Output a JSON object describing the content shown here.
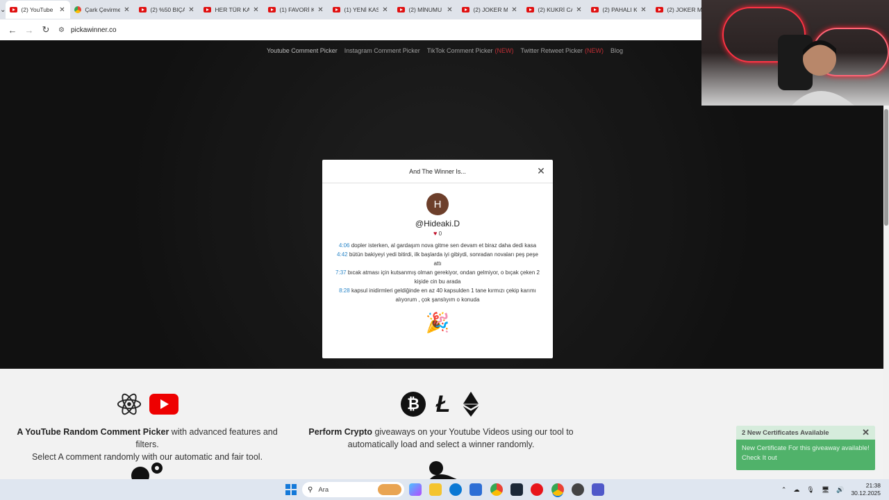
{
  "browser": {
    "tabs": [
      {
        "label": "(2) YouTube",
        "icon": "youtube-icon",
        "active": true
      },
      {
        "label": "Çark Çevirme",
        "icon": "google-icon"
      },
      {
        "label": "(2) %50 BIÇAK",
        "icon": "youtube-icon"
      },
      {
        "label": "HER TÜR KA",
        "icon": "youtube-icon"
      },
      {
        "label": "(1) FAVORİ K",
        "icon": "youtube-icon"
      },
      {
        "label": "(1) YENİ KAS",
        "icon": "youtube-icon"
      },
      {
        "label": "(2) MİNUMU",
        "icon": "youtube-icon"
      },
      {
        "label": "(2) JOKER M",
        "icon": "youtube-icon"
      },
      {
        "label": "(2) KUKRİ CA",
        "icon": "youtube-icon"
      },
      {
        "label": "(2) PAHALI K",
        "icon": "youtube-icon"
      },
      {
        "label": "(2) JOKER M",
        "icon": "youtube-icon"
      }
    ],
    "url": "pickawinner.co"
  },
  "site_nav": {
    "items": [
      {
        "label": "Youtube Comment Picker",
        "badge": ""
      },
      {
        "label": "Instagram Comment Picker",
        "badge": ""
      },
      {
        "label": "TikTok Comment Picker",
        "badge": "(NEW)"
      },
      {
        "label": "Twitter Retweet Picker",
        "badge": "(NEW)"
      },
      {
        "label": "Blog",
        "badge": ""
      }
    ]
  },
  "modal": {
    "title": "And The Winner Is...",
    "avatar_letter": "H",
    "username": "@Hideaki.D",
    "likes": "0",
    "comments": [
      {
        "time": "4:06",
        "text": "dopler isterken, al gardaşım nova gitme sen devam et biraz daha dedi kasa"
      },
      {
        "time": "4:42",
        "text": "bütün bakiyeyi yedi bitirdi, ilk başlarda iyi gibiydi, sonradan novaları peş peşe attı"
      },
      {
        "time": "7:37",
        "text": "bıcak atması için kutsanmış olman gerekiyor, ondan gelmiyor, o bıçak çeken 2 kişide cin bu arada"
      },
      {
        "time": "8:28",
        "text": "kapsul inidirmleri geldiğinde en az 40 kapsulden 1 tane kırmızı çekip karımı alıyorum , çok şanslıyım o konuda"
      }
    ],
    "celebration_icon": "🎉"
  },
  "features": {
    "youtube": {
      "bold": "A YouTube Random Comment Picker",
      "rest": " with advanced features and filters.",
      "line2": "Select A comment randomly with our automatic and fair tool."
    },
    "crypto": {
      "bold": "Perform Crypto",
      "rest": " giveaways on your Youtube Videos using our tool to",
      "line2": "automatically load and select a winner randomly."
    }
  },
  "toast": {
    "title": "2 New Certificates Available",
    "body": "New Certificate For this giveaway available! Check It out"
  },
  "taskbar": {
    "search_placeholder": "Ara",
    "time": "21:38",
    "date": "30.12.2025"
  },
  "colors": {
    "accent_link": "#2a86c8",
    "badge_new": "#e0363e",
    "toast_green": "#34a853",
    "youtube_red": "#e00000"
  }
}
